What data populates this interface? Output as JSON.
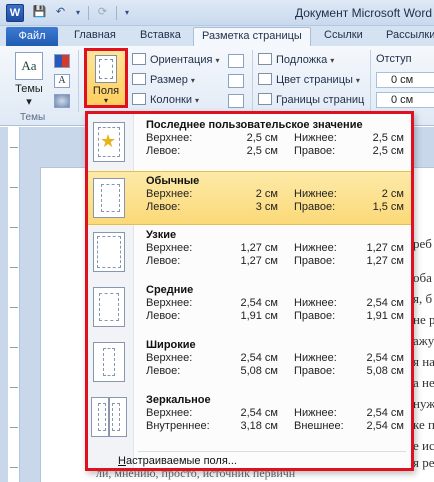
{
  "window": {
    "title": "Документ Microsoft Word –",
    "app_icon_letter": "W"
  },
  "tabs": {
    "file": "Файл",
    "items": [
      "Главная",
      "Вставка",
      "Разметка страницы",
      "Ссылки",
      "Рассылки"
    ],
    "active_index": 2
  },
  "ribbon": {
    "themes_label": "Темы",
    "themes_group_label": "Темы",
    "margins_label": "Поля",
    "orientation": "Ориентация",
    "size": "Размер",
    "columns": "Колонки",
    "watermark": "Подложка",
    "page_color": "Цвет страницы",
    "page_borders": "Границы страниц",
    "indent_label": "Отступ",
    "indent_left": "0 см",
    "indent_right": "0 см"
  },
  "margins_menu": {
    "items": [
      {
        "name": "Последнее пользовательское значение",
        "top_label": "Верхнее:",
        "top": "2,5 см",
        "bottom_label": "Нижнее:",
        "bottom": "2,5 см",
        "left_label": "Левое:",
        "left": "2,5 см",
        "right_label": "Правое:",
        "right": "2,5 см",
        "thumb": "star"
      },
      {
        "name": "Обычные",
        "top_label": "Верхнее:",
        "top": "2 см",
        "bottom_label": "Нижнее:",
        "bottom": "2 см",
        "left_label": "Левое:",
        "left": "3 см",
        "right_label": "Правое:",
        "right": "1,5 см",
        "thumb": "normal",
        "selected": true
      },
      {
        "name": "Узкие",
        "top_label": "Верхнее:",
        "top": "1,27 см",
        "bottom_label": "Нижнее:",
        "bottom": "1,27 см",
        "left_label": "Левое:",
        "left": "1,27 см",
        "right_label": "Правое:",
        "right": "1,27 см",
        "thumb": "narrow"
      },
      {
        "name": "Средние",
        "top_label": "Верхнее:",
        "top": "2,54 см",
        "bottom_label": "Нижнее:",
        "bottom": "2,54 см",
        "left_label": "Левое:",
        "left": "1,91 см",
        "right_label": "Правое:",
        "right": "1,91 см",
        "thumb": "moderate"
      },
      {
        "name": "Широкие",
        "top_label": "Верхнее:",
        "top": "2,54 см",
        "bottom_label": "Нижнее:",
        "bottom": "2,54 см",
        "left_label": "Левое:",
        "left": "5,08 см",
        "right_label": "Правое:",
        "right": "5,08 см",
        "thumb": "wide"
      },
      {
        "name": "Зеркальное",
        "top_label": "Верхнее:",
        "top": "2,54 см",
        "bottom_label": "Нижнее:",
        "bottom": "2,54 см",
        "left_label": "Внутреннее:",
        "left": "3,18 см",
        "right_label": "Внешнее:",
        "right": "2,54 см",
        "thumb": "mirrored"
      }
    ],
    "custom_prefix": "Н",
    "custom_rest": "астраиваемые поля..."
  },
  "document": {
    "fragments": [
      "реб",
      "оба",
      "я, б",
      "не р",
      "ажу",
      "я на",
      "а не",
      "нуж",
      "ке п",
      "е ис",
      "я ре",
      "а. В"
    ],
    "bottom_line": "ли, мнению, просто, источник первичн"
  },
  "colors": {
    "highlight_border": "#e01020",
    "selected_item": "#fbd978",
    "file_tab": "#1f5bb3"
  }
}
